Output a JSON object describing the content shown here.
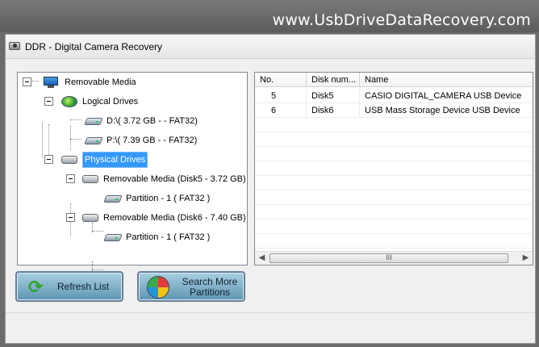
{
  "banner": {
    "text": "www.UsbDriveDataRecovery.com"
  },
  "window": {
    "title": "DDR - Digital Camera Recovery",
    "icon": "camera-icon"
  },
  "tree": {
    "root": {
      "label": "Removable Media",
      "icon": "monitor-icon"
    },
    "logical": {
      "label": "Logical Drives",
      "icon": "disc-icon",
      "items": [
        {
          "label": "D:\\(  3.72 GB -  - FAT32)",
          "icon": "drive-icon"
        },
        {
          "label": "P:\\(  7.39 GB -  - FAT32)",
          "icon": "drive-icon"
        }
      ]
    },
    "physical": {
      "label": "Physical Drives",
      "icon": "hdd-icon",
      "selected": true,
      "disks": [
        {
          "label": "Removable Media (Disk5 - 3.72 GB)",
          "partition": "Partition - 1 ( FAT32 )"
        },
        {
          "label": "Removable Media (Disk6 - 7.40 GB)",
          "partition": "Partition - 1 ( FAT32 )"
        }
      ]
    }
  },
  "table": {
    "columns": [
      "No.",
      "Disk num...",
      "Name"
    ],
    "rows": [
      {
        "no": "5",
        "disk": "Disk5",
        "name": "CASIO DIGITAL_CAMERA USB Device"
      },
      {
        "no": "6",
        "disk": "Disk6",
        "name": "USB Mass  Storage Device USB Device"
      }
    ],
    "scroll_grip": "III"
  },
  "buttons": {
    "refresh": "Refresh List",
    "search_more_line1": "Search More",
    "search_more_line2": "Partitions"
  },
  "colors": {
    "selection": "#3399ff",
    "button_fill": "#5d95b2"
  }
}
